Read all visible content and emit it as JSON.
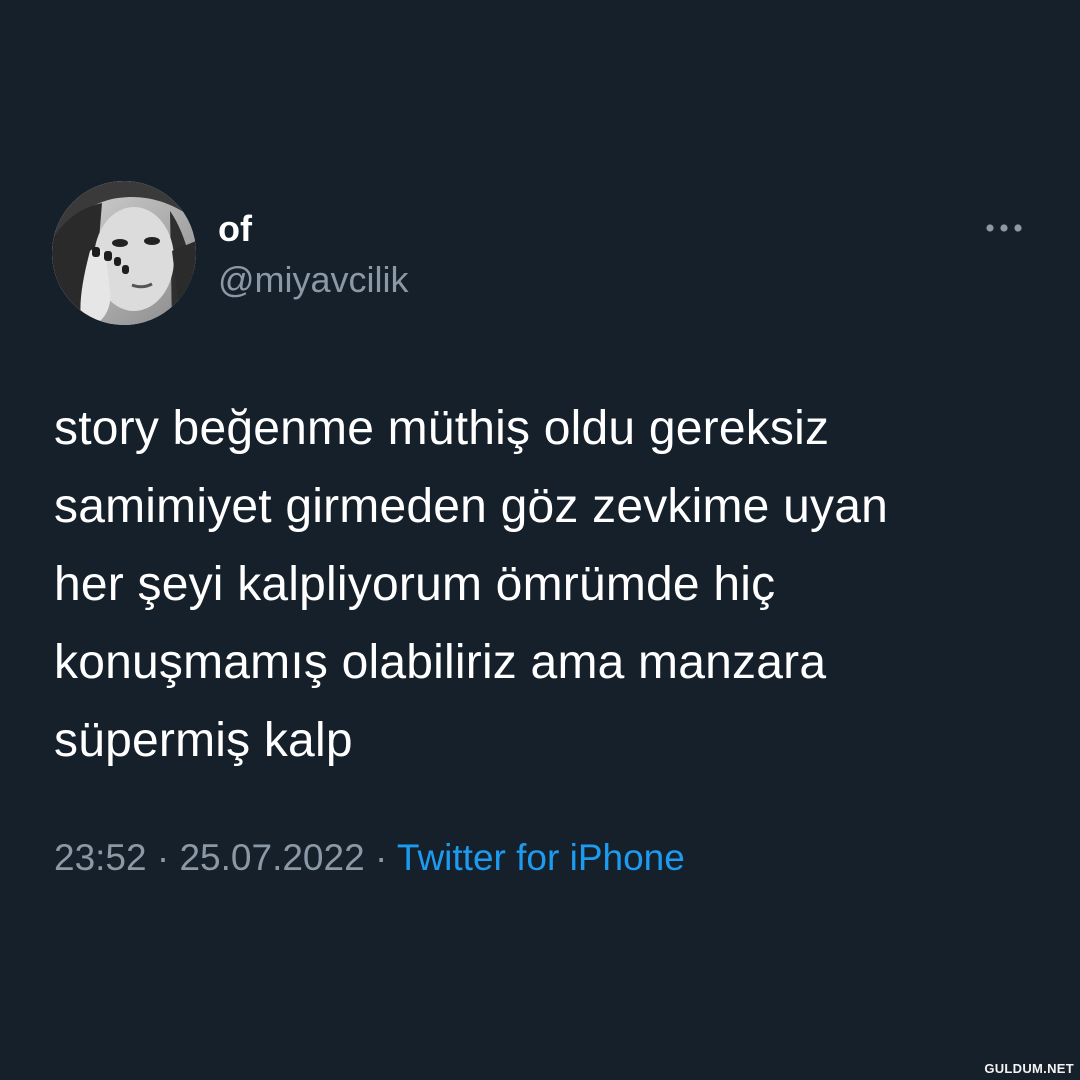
{
  "tweet": {
    "author": {
      "display_name": "of",
      "handle": "@miyavcilik",
      "avatar_icon": "profile-photo"
    },
    "more_icon": "ellipsis-icon",
    "text_lines": [
      "story beğenme müthiş oldu gereksiz",
      "samimiyet girmeden göz zevkime uyan",
      "her şeyi kalpliyorum ömrümde hiç",
      "konuşmamış olabiliriz ama manzara",
      "süpermiş kalp"
    ],
    "time": "23:52",
    "separator": "·",
    "date": "25.07.2022",
    "source": "Twitter for iPhone"
  },
  "watermark": "GULDUM.NET",
  "colors": {
    "background": "#15202b",
    "text": "#ffffff",
    "secondary": "#8b98a5",
    "accent": "#1d9bf0"
  }
}
